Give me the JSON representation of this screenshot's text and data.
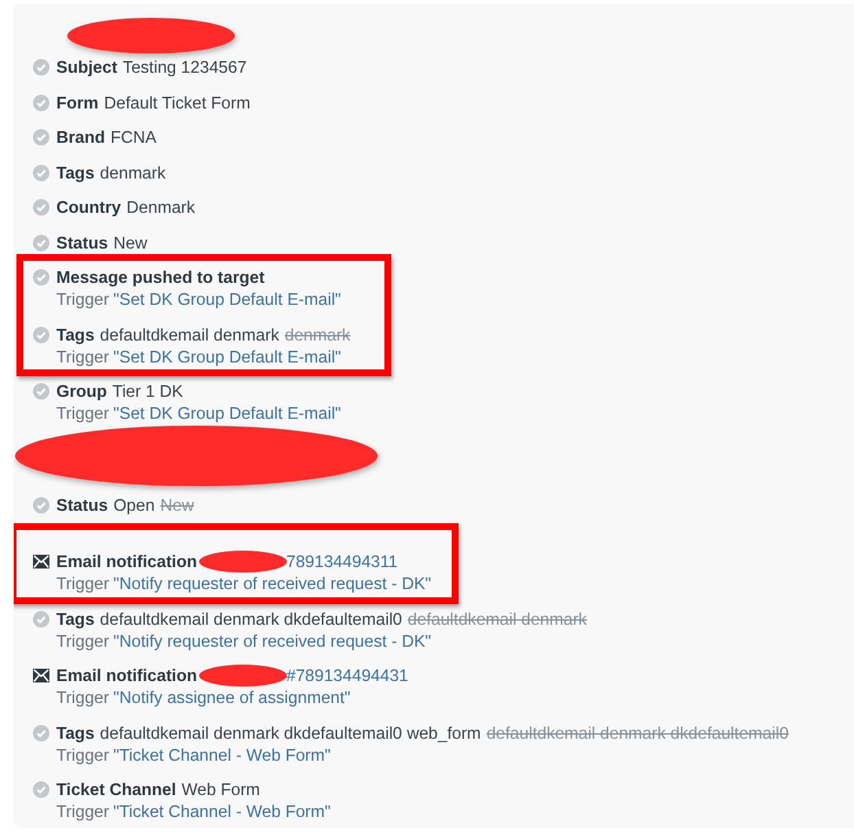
{
  "groups": [
    {
      "entries": [
        {
          "kind": "field",
          "label": "Subject",
          "value": "Testing 1234567",
          "highlighted": false
        },
        {
          "kind": "field",
          "label": "Form",
          "value": "Default Ticket Form",
          "highlighted": false
        },
        {
          "kind": "field",
          "label": "Brand",
          "value": "FCNA",
          "highlighted": false
        },
        {
          "kind": "field",
          "label": "Tags",
          "value": "denmark",
          "highlighted": false
        },
        {
          "kind": "field",
          "label": "Country",
          "value": "Denmark",
          "highlighted": false
        },
        {
          "kind": "field",
          "label": "Status",
          "value": "New",
          "highlighted": false
        },
        {
          "kind": "field",
          "label": "Message pushed to target",
          "trigger_label": "Trigger",
          "trigger_name": "\"Set DK Group Default E-mail\"",
          "highlighted": true
        },
        {
          "kind": "field",
          "label": "Tags",
          "value": "defaultdkemail denmark",
          "removed": "denmark",
          "trigger_label": "Trigger",
          "trigger_name": "\"Set DK Group Default E-mail\"",
          "highlighted": true
        },
        {
          "kind": "field",
          "label": "Group",
          "value": "Tier 1 DK",
          "trigger_label": "Trigger",
          "trigger_name": "\"Set DK Group Default E-mail\"",
          "highlighted": false
        }
      ]
    },
    {
      "entries": [
        {
          "kind": "field",
          "label": "Status",
          "value": "Open",
          "removed": "New",
          "highlighted": false
        },
        {
          "kind": "email",
          "label": "Email notification",
          "link": "789134494311",
          "trigger_label": "Trigger",
          "trigger_name": "\"Notify requester of received request - DK\"",
          "highlighted": true
        },
        {
          "kind": "field",
          "label": "Tags",
          "value": "defaultdkemail denmark dkdefaultemail0",
          "removed": "defaultdkemail denmark",
          "trigger_label": "Trigger",
          "trigger_name": "\"Notify requester of received request - DK\"",
          "highlighted": false
        },
        {
          "kind": "email",
          "label": "Email notification",
          "link": "#789134494431",
          "trigger_label": "Trigger",
          "trigger_name": "\"Notify assignee of assignment\"",
          "highlighted": false
        },
        {
          "kind": "field",
          "label": "Tags",
          "value": "defaultdkemail denmark dkdefaultemail0 web_form",
          "removed": "defaultdkemail denmark dkdefaultemail0",
          "trigger_label": "Trigger",
          "trigger_name": "\"Ticket Channel - Web Form\"",
          "highlighted": false
        },
        {
          "kind": "field",
          "label": "Ticket Channel",
          "value": "Web Form",
          "trigger_label": "Trigger",
          "trigger_name": "\"Ticket Channel - Web Form\"",
          "highlighted": false
        }
      ]
    }
  ]
}
